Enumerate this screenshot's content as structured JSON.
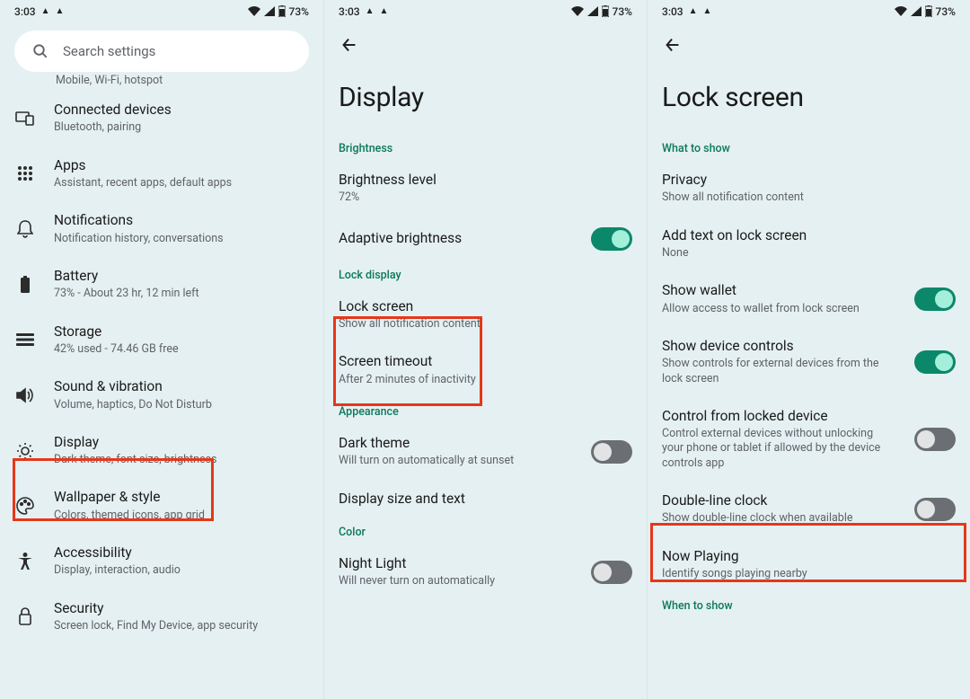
{
  "status": {
    "time": "3:03",
    "battery": "73%"
  },
  "panel1": {
    "search_placeholder": "Search settings",
    "cut_sub": "Mobile, Wi-Fi, hotspot",
    "items": [
      {
        "title": "Connected devices",
        "sub": "Bluetooth, pairing"
      },
      {
        "title": "Apps",
        "sub": "Assistant, recent apps, default apps"
      },
      {
        "title": "Notifications",
        "sub": "Notification history, conversations"
      },
      {
        "title": "Battery",
        "sub": "73% - About 23 hr, 12 min left"
      },
      {
        "title": "Storage",
        "sub": "42% used - 74.46 GB free"
      },
      {
        "title": "Sound & vibration",
        "sub": "Volume, haptics, Do Not Disturb"
      },
      {
        "title": "Display",
        "sub": "Dark theme, font size, brightness"
      },
      {
        "title": "Wallpaper & style",
        "sub": "Colors, themed icons, app grid"
      },
      {
        "title": "Accessibility",
        "sub": "Display, interaction, audio"
      },
      {
        "title": "Security",
        "sub": "Screen lock, Find My Device, app security"
      }
    ]
  },
  "panel2": {
    "title": "Display",
    "sections": {
      "brightness": "Brightness",
      "lock": "Lock display",
      "appearance": "Appearance",
      "color": "Color"
    },
    "items": {
      "brightness_level": {
        "title": "Brightness level",
        "sub": "72%"
      },
      "adaptive": {
        "title": "Adaptive brightness"
      },
      "lock_screen": {
        "title": "Lock screen",
        "sub": "Show all notification content"
      },
      "timeout": {
        "title": "Screen timeout",
        "sub": "After 2 minutes of inactivity"
      },
      "dark_theme": {
        "title": "Dark theme",
        "sub": "Will turn on automatically at sunset"
      },
      "display_size": {
        "title": "Display size and text"
      },
      "night_light": {
        "title": "Night Light",
        "sub": "Will never turn on automatically"
      }
    }
  },
  "panel3": {
    "title": "Lock screen",
    "sections": {
      "what": "What to show",
      "when": "When to show"
    },
    "items": {
      "privacy": {
        "title": "Privacy",
        "sub": "Show all notification content"
      },
      "add_text": {
        "title": "Add text on lock screen",
        "sub": "None"
      },
      "wallet": {
        "title": "Show wallet",
        "sub": "Allow access to wallet from lock screen"
      },
      "device_controls": {
        "title": "Show device controls",
        "sub": "Show controls for external devices from the lock screen"
      },
      "control_locked": {
        "title": "Control from locked device",
        "sub": "Control external devices without unlocking your phone or tablet if allowed by the device controls app"
      },
      "double_line": {
        "title": "Double-line clock",
        "sub": "Show double-line clock when available"
      },
      "now_playing": {
        "title": "Now Playing",
        "sub": "Identify songs playing nearby"
      }
    }
  }
}
